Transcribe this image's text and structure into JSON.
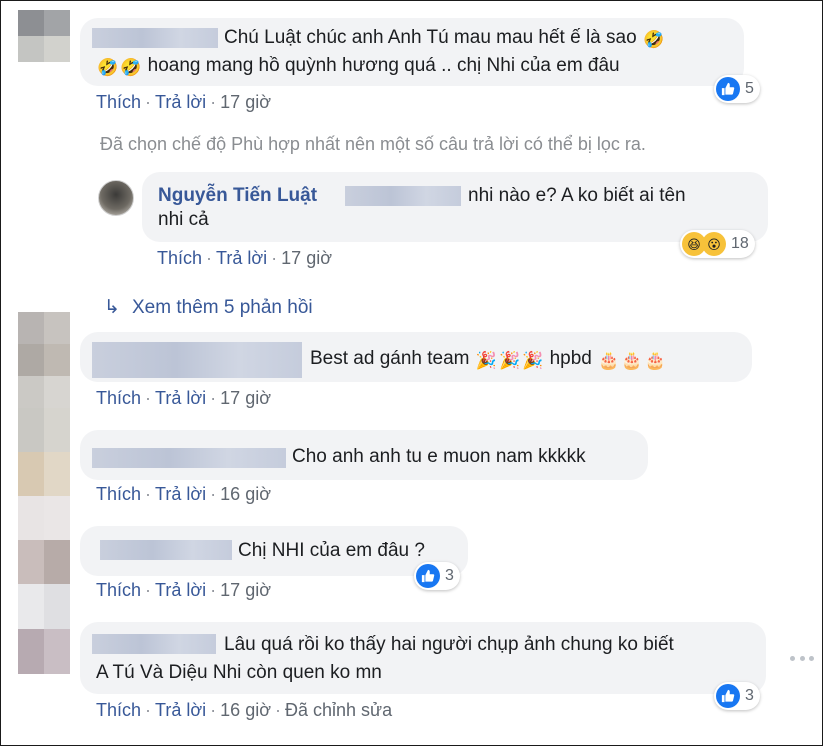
{
  "reply_action": "Thích",
  "reply_link": "Trả lời",
  "filter_notice": "Đã chọn chế độ Phù hợp nhất nên một số câu trả lời có thể bị lọc ra.",
  "view_more": "Xem thêm 5 phản hồi",
  "colors": {
    "link": "#385898",
    "bubble": "#f2f3f5",
    "like": "#1877f2"
  },
  "comments": [
    {
      "line1": "Chú Luật chúc anh Anh Tú mau mau hết ế là sao",
      "line2": "hoang mang hồ quỳnh hương quá .. chị Nhi của em đâu",
      "emoji_icons": [
        "rofl-emoji",
        "rofl-emoji",
        "rofl-emoji"
      ],
      "like_label": "Thích",
      "reply_label": "Trả lời",
      "time": "17 giờ",
      "reaction_count": "5",
      "reaction_icons": [
        "like-icon"
      ]
    },
    {
      "author": "Nguyễn Tiến Luật",
      "line1": "nhi nào e? A ko biết ai tên",
      "line2": "nhi cả",
      "like_label": "Thích",
      "reply_label": "Trả lời",
      "time": "17 giờ",
      "reaction_count": "18",
      "reaction_icons": [
        "haha-icon",
        "wow-icon"
      ]
    },
    {
      "line1": "Best ad gánh team",
      "line1b": "hpbd",
      "emoji_icons": [
        "party-popper-emoji",
        "party-popper-emoji",
        "party-popper-emoji",
        "cake-emoji",
        "cake-emoji",
        "cake-emoji"
      ],
      "like_label": "Thích",
      "reply_label": "Trả lời",
      "time": "17 giờ"
    },
    {
      "line1": "Cho anh anh tu e muon nam kkkkk",
      "like_label": "Thích",
      "reply_label": "Trả lời",
      "time": "16 giờ"
    },
    {
      "line1": "Chị NHI của em đâu ?",
      "like_label": "Thích",
      "reply_label": "Trả lời",
      "time": "17 giờ",
      "reaction_count": "3",
      "reaction_icons": [
        "like-icon"
      ]
    },
    {
      "line1": "Lâu quá rồi ko thấy hai người chụp ảnh chung ko biết",
      "line2": "A Tú Và Diệu Nhi còn quen ko mn",
      "like_label": "Thích",
      "reply_label": "Trả lời",
      "time": "16 giờ",
      "edited": "Đã chỉnh sửa",
      "reaction_count": "3",
      "reaction_icons": [
        "like-icon"
      ]
    }
  ]
}
